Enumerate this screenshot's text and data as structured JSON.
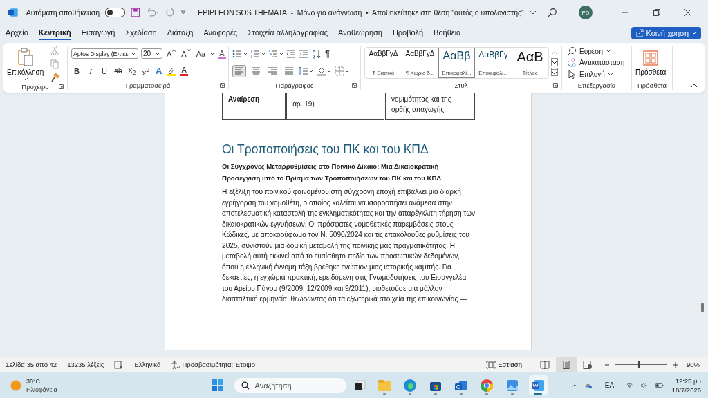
{
  "title_bar": {
    "autosave_label": "Αυτόματη αποθήκευση",
    "autosave_on": false,
    "document_title": "EPIPLEON SOS THEMATA  -  Μόνο για ανάγνωση  •  Αποθηκεύτηκε στη θέση \"αυτός ο υπολογιστής\"",
    "avatar": "PD"
  },
  "menu_tabs": [
    {
      "label": "Αρχείο",
      "selected": false
    },
    {
      "label": "Κεντρική",
      "selected": true
    },
    {
      "label": "Εισαγωγή",
      "selected": false
    },
    {
      "label": "Σχεδίαση",
      "selected": false
    },
    {
      "label": "Διάταξη",
      "selected": false
    },
    {
      "label": "Αναφορές",
      "selected": false
    },
    {
      "label": "Στοιχεία αλληλογραφίας",
      "selected": false
    },
    {
      "label": "Αναθεώρηση",
      "selected": false
    },
    {
      "label": "Προβολή",
      "selected": false
    },
    {
      "label": "Βοήθεια",
      "selected": false
    }
  ],
  "share_button": "Κοινή χρήση",
  "ribbon": {
    "clipboard": {
      "paste": "Επικόλληση",
      "group": "Πρόχειρο"
    },
    "font": {
      "font_name": "Aptos Display (Επικε",
      "font_size": "20",
      "grow": "A",
      "shrink": "A",
      "change_case": "Aa",
      "clear": "A",
      "buttons": [
        {
          "label": "B",
          "kind": "bold"
        },
        {
          "label": "I",
          "kind": "italic"
        },
        {
          "label": "U",
          "kind": "underline"
        },
        {
          "label": "ab",
          "kind": "strike"
        },
        {
          "label": "x$_{2}$",
          "kind": "sub"
        },
        {
          "label": "x$^{2}$",
          "kind": "sup"
        }
      ],
      "text_effects": "A",
      "font_color": "A",
      "group": "Γραμματοσειρά"
    },
    "paragraph": {
      "pilcrow": "¶",
      "align": [
        {
          "kind": "left",
          "selected": true
        },
        {
          "kind": "center",
          "selected": false
        },
        {
          "kind": "right",
          "selected": false
        },
        {
          "kind": "justify",
          "selected": false
        }
      ],
      "group": "Παράγραφος"
    },
    "styles": {
      "items": [
        {
          "sample": "ΑαΒβΓγΔ",
          "name": "¶ Βασικό",
          "kind": "normal",
          "selected": false
        },
        {
          "sample": "ΑαΒβΓγΔ",
          "name": "¶ Χωρίς δ...",
          "kind": "normal",
          "selected": false
        },
        {
          "sample": "ΑαΒβ",
          "name": "Επικεφαλί...",
          "kind": "heading1",
          "selected": true
        },
        {
          "sample": "ΑαΒβΓγ",
          "name": "Επικεφαλί...",
          "kind": "heading2",
          "selected": false
        },
        {
          "sample": "ΑαΒ",
          "name": "Τίτλος",
          "kind": "title",
          "selected": false
        }
      ],
      "group": "Στυλ"
    },
    "editing": {
      "items": [
        {
          "label": "Εύρεση",
          "kind": "find"
        },
        {
          "label": "Αντικατάσταση",
          "kind": "replace"
        },
        {
          "label": "Επιλογή",
          "kind": "select"
        }
      ],
      "group": "Επεξεργασία"
    },
    "addins": {
      "label": "Πρόσθετα",
      "group": "Πρόσθετα"
    }
  },
  "document": {
    "table_cells": [
      {
        "text": "Αναίρεση",
        "bold": true
      },
      {
        "text": "αρ. 19)",
        "bold": false
      },
      {
        "text": "νομιμότητας και της ορθής υπαγωγής.",
        "bold": false
      }
    ],
    "heading": "Οι Τροποποιήσεις του ΠΚ και του ΚΠΔ",
    "subheading": "Οι Σύγχρονες Μεταρρυθμίσεις στο Ποινικό Δίκαιο: Μια Δικαιοκρατική Προσέγγιση υπό το Πρίσμα των Τροποποιήσεων του ΠΚ και του ΚΠΔ",
    "body": "Η εξέλιξη του ποινικού φαινομένου στη σύγχρονη εποχή επιβάλλει μια διαρκή εγρήγορση του νομοθέτη, ο οποίος καλείται να ισορροπήσει ανάμεσα στην αποτελεσματική καταστολή της εγκληματικότητας και την απαρέγκλιτη τήρηση των δικαιοκρατικών εγγυήσεων. Οι πρόσφατες νομοθετικές παρεμβάσεις στους Κώδικες, με αποκορύφωμα τον Ν. 5090/2024 και τις επακόλουθες ρυθμίσεις του 2025, συνιστούν μια δομική μεταβολή της ποινικής μας πραγματικότητας. Η μεταβολή αυτή εκκινεί από το ευαίσθητο πεδίο των προσωπικών δεδομένων, όπου η ελληνική έννομη τάξη βρέθηκε ενώπιον μιας ιστορικής καμπής. Για δεκαετίες, η εγχώρια πρακτική, ερειδόμενη στις Γνωμοδοτήσεις του Εισαγγελέα του Αρείου Πάγου (9/2009, 12/2009 και 9/2011), υιοθετούσε μια μάλλον διασταλτική ερμηνεία, θεωρώντας ότι τα εξωτερικά στοιχεία της επικοινωνίας —"
  },
  "status_bar": {
    "page": "Σελίδα 35 από 42",
    "words": "13235 λέξεις",
    "language": "Ελληνικά",
    "accessibility": "Προσβασιμότητα: Έτοιμο",
    "focus": "Εστίαση",
    "views": [
      {
        "kind": "read",
        "selected": false
      },
      {
        "kind": "print",
        "selected": true
      },
      {
        "kind": "web",
        "selected": false
      }
    ],
    "zoom": {
      "level": 0.45,
      "reading": "90%"
    }
  },
  "taskbar": {
    "temperature": "30°C",
    "weather": "Ηλιοφάνεια",
    "search_placeholder": "Αναζήτηση",
    "apps": [
      {
        "kind": "files",
        "active": false
      },
      {
        "kind": "edge",
        "active": false
      },
      {
        "kind": "store",
        "active": false
      },
      {
        "kind": "outlook",
        "active": false
      },
      {
        "kind": "chrome",
        "active": false
      },
      {
        "kind": "photos",
        "active": false
      },
      {
        "kind": "word",
        "active": true
      }
    ],
    "language": "ΕΛ",
    "time": "12:25 μμ",
    "date": "18/7/2026"
  }
}
